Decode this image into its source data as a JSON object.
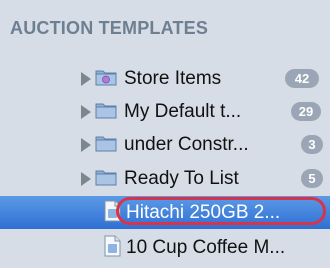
{
  "sidebar": {
    "section_title": "AUCTION TEMPLATES",
    "folders": [
      {
        "label": "Store Items",
        "count": "42",
        "icon": "store-folder-icon"
      },
      {
        "label": "My Default t...",
        "count": "29",
        "icon": "folder-icon"
      },
      {
        "label": "under Constr...",
        "count": "3",
        "icon": "folder-icon"
      },
      {
        "label": "Ready To List",
        "count": "5",
        "icon": "folder-icon"
      }
    ],
    "items": [
      {
        "label": "Hitachi 250GB 2...",
        "selected": true,
        "icon": "document-icon"
      },
      {
        "label": "10 Cup Coffee M...",
        "selected": false,
        "icon": "document-icon"
      }
    ]
  },
  "colors": {
    "background": "#d6dde6",
    "header_text": "#6e7f92",
    "badge": "#9aa6b5",
    "selection": "#3b7ddd",
    "highlight_oval": "#d9334a"
  }
}
